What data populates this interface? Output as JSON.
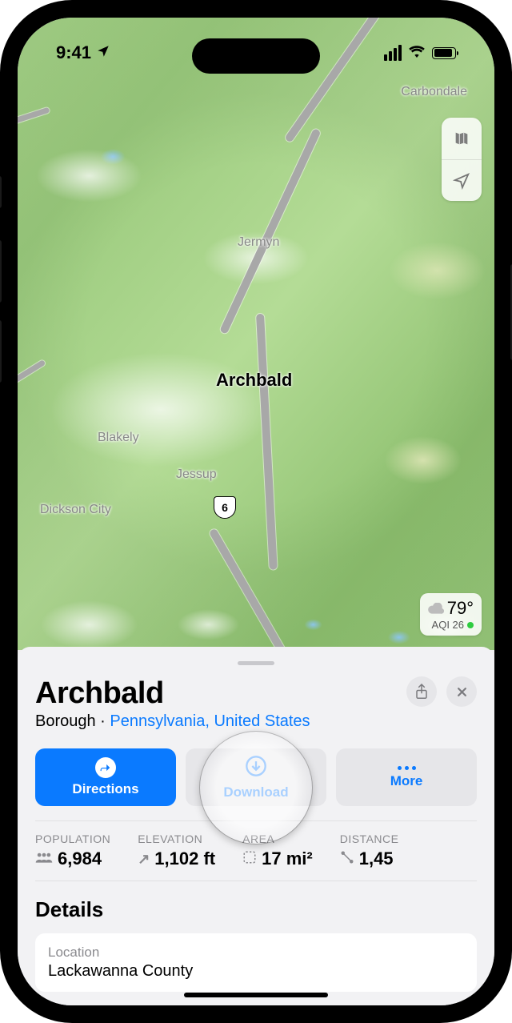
{
  "status": {
    "time": "9:41"
  },
  "map": {
    "labels": {
      "carbondale": "Carbondale",
      "jermyn": "Jermyn",
      "archbald": "Archbald",
      "blakely": "Blakely",
      "jessup": "Jessup",
      "dickson_city": "Dickson City",
      "route_shield": "6"
    },
    "weather": {
      "temp": "79°",
      "aqi": "AQI 26"
    }
  },
  "sheet": {
    "title": "Archbald",
    "subtitle_type": "Borough",
    "subtitle_sep": " · ",
    "subtitle_region": "Pennsylvania, United States",
    "actions": {
      "directions": "Directions",
      "download": "Download",
      "more": "More"
    },
    "stats": {
      "population": {
        "label": "POPULATION",
        "value": "6,984"
      },
      "elevation": {
        "label": "ELEVATION",
        "value": "1,102 ft"
      },
      "area": {
        "label": "AREA",
        "value": "17 mi²"
      },
      "distance": {
        "label": "DISTANCE",
        "value": "1,45"
      }
    },
    "details_heading": "Details",
    "details": {
      "location_label": "Location",
      "location_value": "Lackawanna County"
    }
  }
}
